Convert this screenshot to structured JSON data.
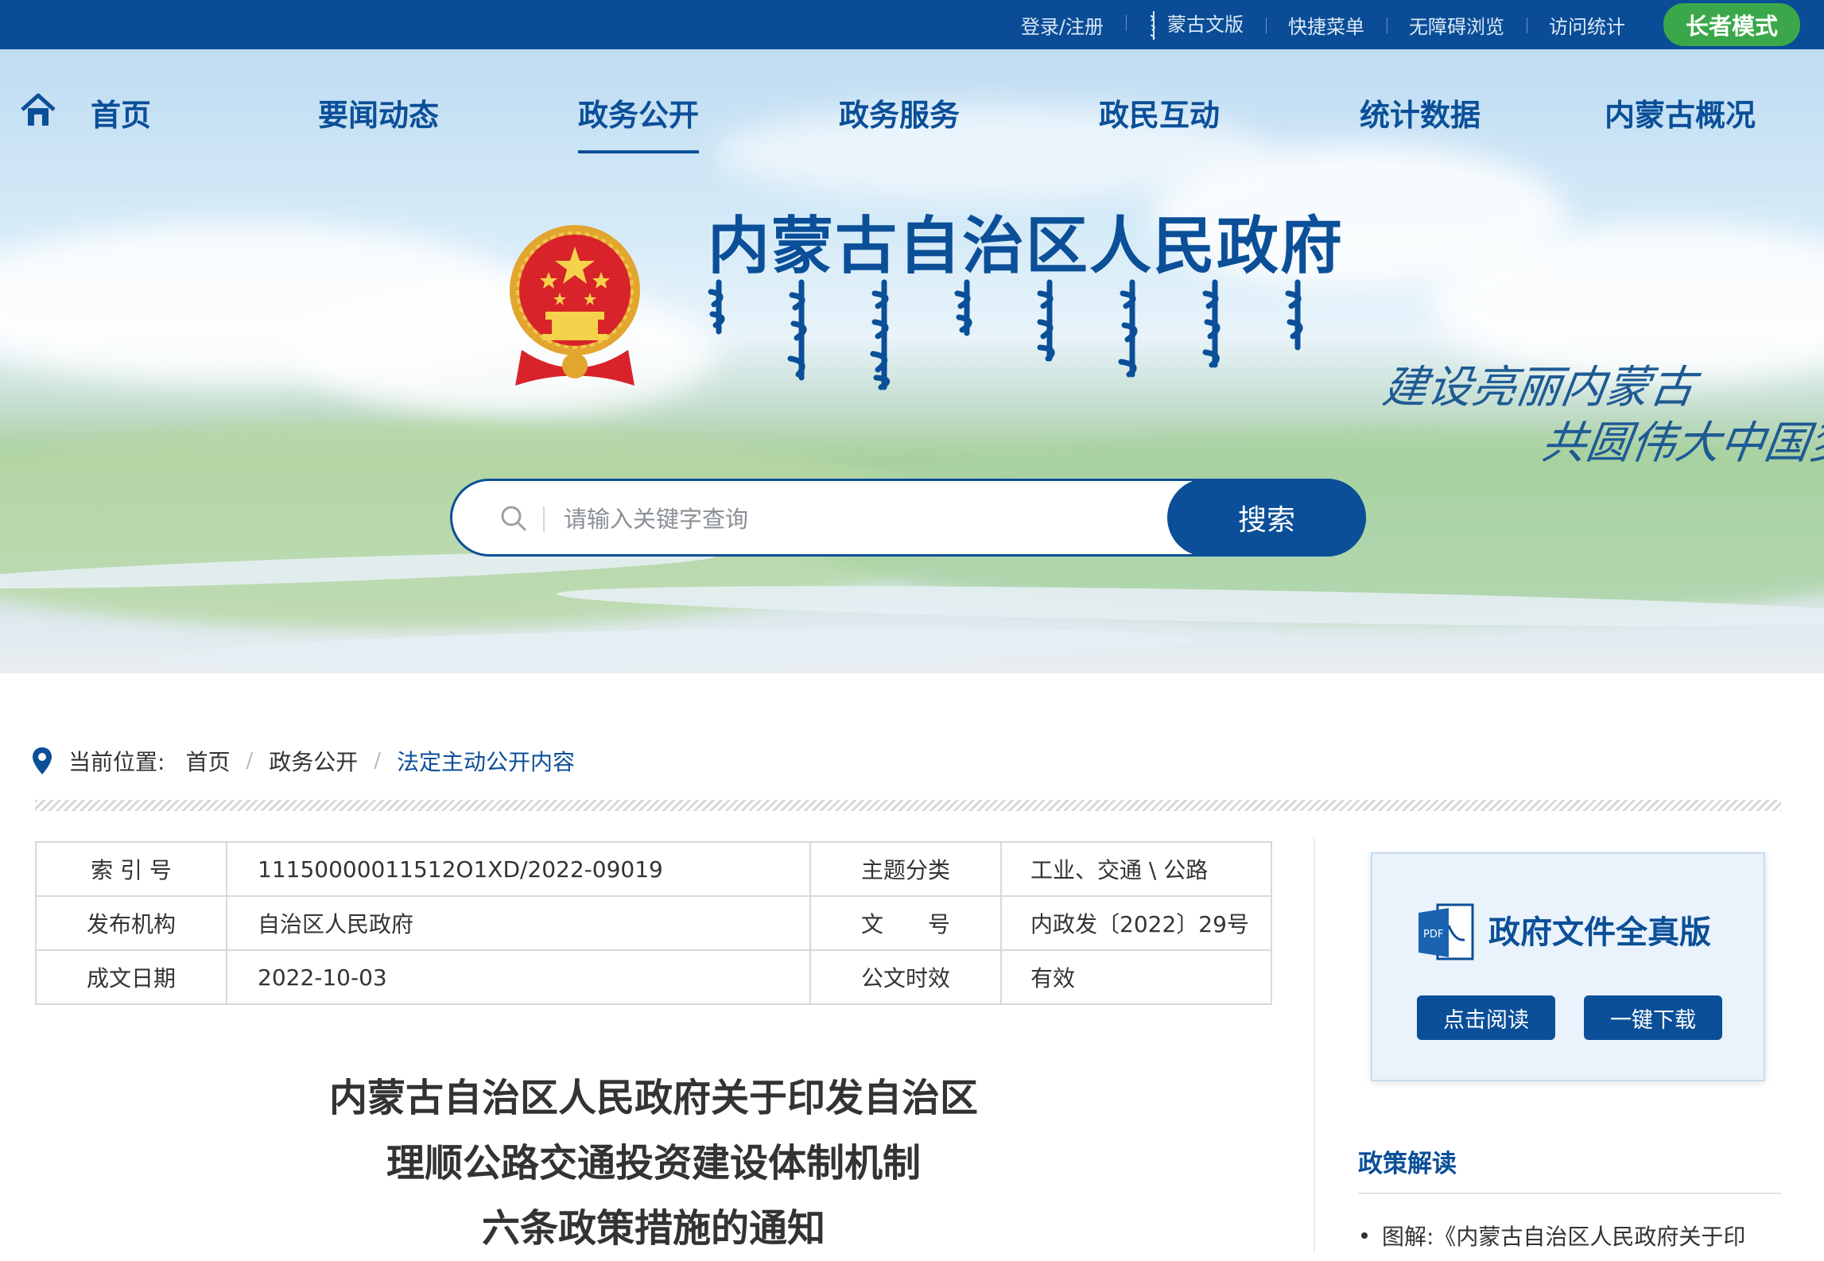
{
  "topbar": {
    "login": "登录/注册",
    "mongolian": "蒙古文版",
    "quick_menu": "快捷菜单",
    "accessible": "无障碍浏览",
    "stats": "访问统计",
    "elder_mode": "长者模式"
  },
  "nav": {
    "items": [
      "首页",
      "要闻动态",
      "政务公开",
      "政务服务",
      "政民互动",
      "统计数据",
      "内蒙古概况"
    ],
    "active": "政务公开"
  },
  "banner": {
    "title": "内蒙古自治区人民政府",
    "slogan_line1": "建设亮丽内蒙古",
    "slogan_line2": "共圆伟大中国梦"
  },
  "search": {
    "placeholder": "请输入关键字查询",
    "button": "搜索"
  },
  "breadcrumb": {
    "label": "当前位置:",
    "items": [
      "首页",
      "政务公开",
      "法定主动公开内容"
    ]
  },
  "info": {
    "index_label": "索 引 号",
    "index_value": "11150000011512O1XD/2022-09019",
    "topic_label": "主题分类",
    "topic_value": "工业、交通 \\ 公路",
    "org_label": "发布机构",
    "org_value": "自治区人民政府",
    "docno_label": "文　　号",
    "docno_value": "内政发〔2022〕29号",
    "date_label": "成文日期",
    "date_value": "2022-10-03",
    "validity_label": "公文时效",
    "validity_value": "有效"
  },
  "doc_title": {
    "line1": "内蒙古自治区人民政府关于印发自治区",
    "line2": "理顺公路交通投资建设体制机制",
    "line3": "六条政策措施的通知"
  },
  "doc_card": {
    "pdf_label": "PDF",
    "title": "政府文件全真版",
    "read": "点击阅读",
    "download": "一键下载"
  },
  "policy": {
    "title": "政策解读",
    "item": "图解:《内蒙古自治区人民政府关于印"
  },
  "colors": {
    "brand_blue": "#0b4f98",
    "topbar_blue": "#0a4d96",
    "elder_green": "#3aa84a"
  }
}
